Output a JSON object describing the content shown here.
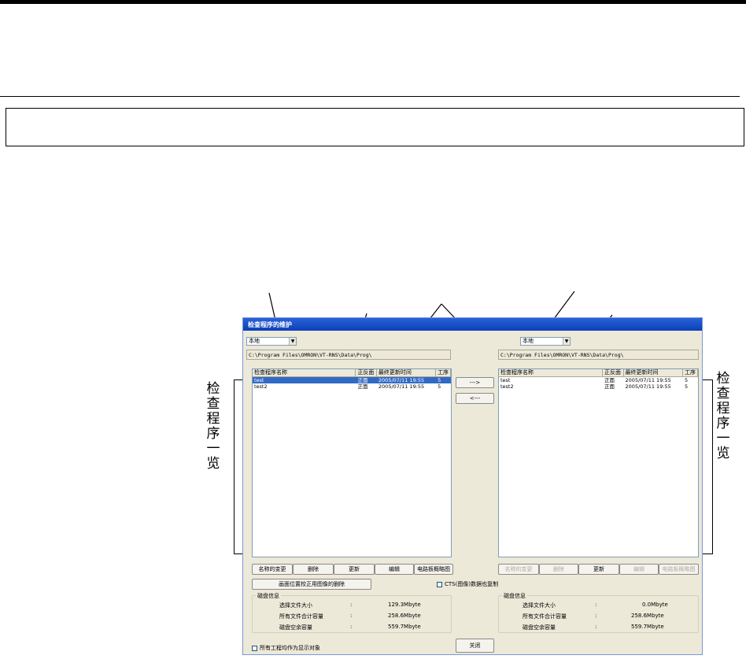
{
  "side_label": "检查程序一览",
  "dialog": {
    "title": "检查程序的维护",
    "columns": [
      "检查程序名称",
      "正反面",
      "最终更新时间",
      "工序"
    ],
    "transfer_right": "--->",
    "transfer_left": "<---",
    "left": {
      "location": "本地",
      "path": "C:\\Program Files\\OMRON\\VT-RNS\\Data\\Prog\\",
      "rows": [
        [
          "test",
          "正面",
          "2005/07/11  19:55",
          "5"
        ],
        [
          "test2",
          "正面",
          "2005/07/11  19:55",
          "5"
        ]
      ],
      "buttons": [
        "名称的变更",
        "删除",
        "更新",
        "编辑",
        "电路板概略图"
      ],
      "delete_image_button": "画面位置校正用图像的删除",
      "disk": {
        "title": "磁盘信息",
        "labels": [
          "选择文件大小",
          "所有文件合计容量",
          "磁盘空余容量"
        ],
        "sep": ":",
        "values": [
          "129.3Mbyte",
          "258.6Mbyte",
          "559.7Mbyte"
        ]
      }
    },
    "right": {
      "location": "本地",
      "path": "C:\\Program Files\\OMRON\\VT-RNS\\Data\\Prog\\",
      "rows": [
        [
          "test",
          "正面",
          "2005/07/11  19:55",
          "5"
        ],
        [
          "test2",
          "正面",
          "2005/07/11  19:55",
          "5"
        ]
      ],
      "buttons": [
        "名称的变更",
        "删除",
        "更新",
        "编辑",
        "电路板概略图"
      ],
      "disk": {
        "title": "磁盘信息",
        "labels": [
          "选择文件大小",
          "所有文件合计容量",
          "磁盘空余容量"
        ],
        "sep": ":",
        "values": [
          "0.0Mbyte",
          "258.6Mbyte",
          "559.7Mbyte"
        ]
      }
    },
    "cts_checkbox": "CTS(图像)数据也复制",
    "all_projects_checkbox": "所有工程均作为显示对象",
    "close_button": "关闭"
  }
}
